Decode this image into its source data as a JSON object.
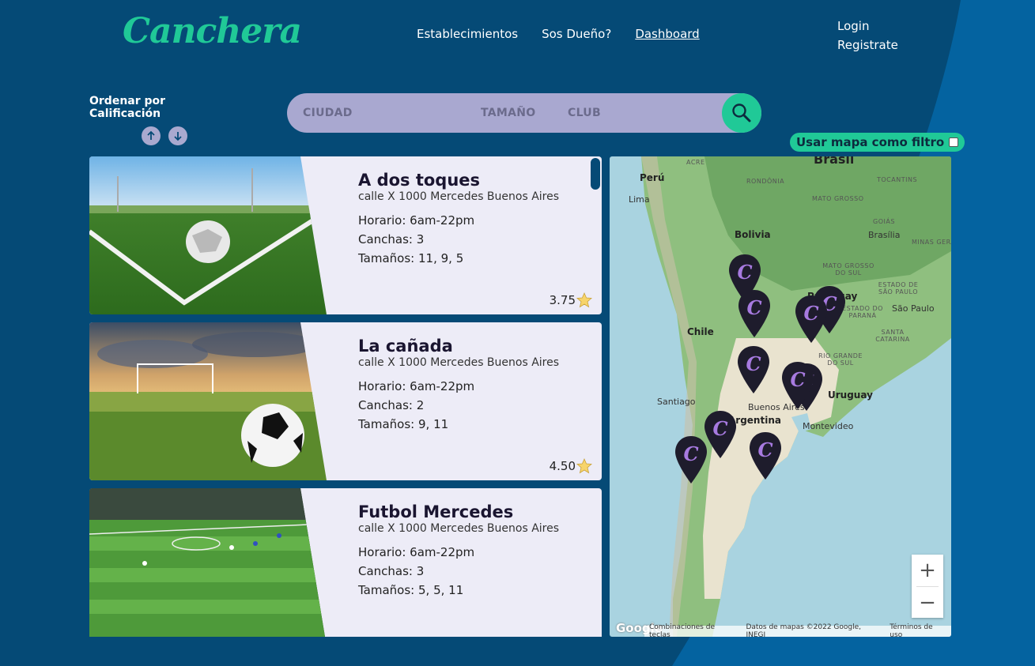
{
  "brand": {
    "logo": "Canchera",
    "accent": "#20c997",
    "background": "#054a76"
  },
  "nav": {
    "items": [
      "Establecimientos",
      "Sos Dueño?",
      "Dashboard"
    ],
    "active": "Dashboard"
  },
  "auth": {
    "login": "Login",
    "register": "Registrate"
  },
  "sort": {
    "label": "Ordenar por Calificación",
    "asc_icon": "arrow-up-icon",
    "desc_icon": "arrow-down-icon"
  },
  "search": {
    "city": "CIUDAD",
    "size": "TAMAÑO",
    "club": "CLUB",
    "icon": "search-icon"
  },
  "map_filter": {
    "label": "Usar mapa como filtro",
    "checked": false
  },
  "venues": [
    {
      "name": "A dos toques",
      "address": "calle X 1000 Mercedes Buenos Aires",
      "hours": "Horario: 6am-22pm",
      "courts": "Canchas: 3",
      "sizes": "Tamaños: 11, 9, 5",
      "rating": "3.75"
    },
    {
      "name": "La cañada",
      "address": "calle X 1000 Mercedes Buenos Aires",
      "hours": "Horario: 6am-22pm",
      "courts": "Canchas: 2",
      "sizes": "Tamaños: 9, 11",
      "rating": "4.50"
    },
    {
      "name": "Futbol Mercedes",
      "address": "calle X 1000 Mercedes Buenos Aires",
      "hours": "Horario: 6am-22pm",
      "courts": "Canchas: 3",
      "sizes": "Tamaños: 5, 5, 11",
      "rating": ""
    }
  ],
  "map": {
    "labels": {
      "brasil": "Brasil",
      "peru": "Perú",
      "lima": "Lima",
      "bolivia": "Bolivia",
      "chile": "Chile",
      "paraguay": "Paraguay",
      "uruguay": "Uruguay",
      "argentina": "Argentina",
      "santiago": "Santiago",
      "buenos_aires": "Buenos Aires",
      "montevideo": "Montevideo",
      "brasilia": "Brasília",
      "sao_paulo": "São Paulo",
      "acre": "ACRE",
      "rondonia": "RONDÔNIA",
      "mato_grosso": "MATO GROSSO",
      "tocantins": "TOCANTINS",
      "goias": "GOIÁS",
      "minas": "MINAS GERAI",
      "mato_grosso_sul": "MATO GROSSO DO SUL",
      "estado_sp": "ESTADO DE SÃO PAULO",
      "parana": "ESTADO DO PARANÁ",
      "santa_catarina": "SANTA CATARINA",
      "rio_grande": "RIO GRANDE DO SUL"
    },
    "zoom_in": "+",
    "zoom_out": "−",
    "google": "Google",
    "attrib": [
      "Combinaciones de teclas",
      "Datos de mapas ©2022 Google, INEGI",
      "Términos de uso"
    ],
    "pin_letter": "C"
  }
}
